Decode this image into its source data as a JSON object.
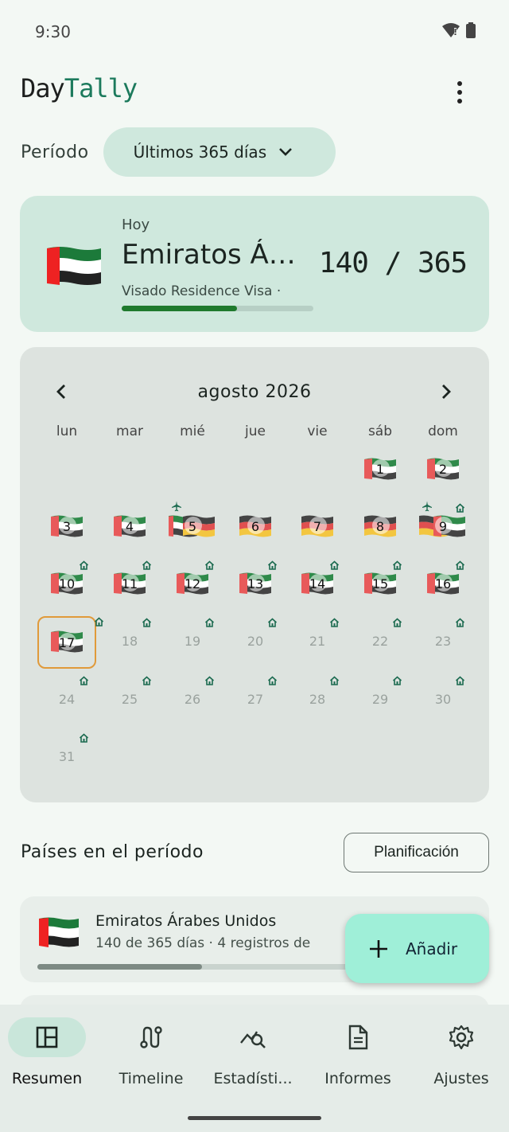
{
  "status": {
    "time": "9:30"
  },
  "app": {
    "name_part1": "Day",
    "name_part2": "Tally"
  },
  "period": {
    "label": "Período",
    "selected": "Últimos 365 días"
  },
  "today": {
    "label": "Hoy",
    "country": "Emiratos Árabes Unidos",
    "visa": "Visado Residence Visa ·",
    "count": "140 / 365",
    "progress_fraction": 0.6,
    "flag": "ae"
  },
  "calendar": {
    "month_title": "agosto 2026",
    "weekdays": [
      "lun",
      "mar",
      "mié",
      "jue",
      "vie",
      "sáb",
      "dom"
    ],
    "days": [
      {
        "n": "1",
        "col": 5,
        "row": 0,
        "flag": "ae"
      },
      {
        "n": "2",
        "col": 6,
        "row": 0,
        "flag": "ae"
      },
      {
        "n": "3",
        "col": 0,
        "row": 1,
        "flag": "ae"
      },
      {
        "n": "4",
        "col": 1,
        "row": 1,
        "flag": "ae"
      },
      {
        "n": "5",
        "col": 2,
        "row": 1,
        "flag": "ae-de",
        "plane": true
      },
      {
        "n": "6",
        "col": 3,
        "row": 1,
        "flag": "de"
      },
      {
        "n": "7",
        "col": 4,
        "row": 1,
        "flag": "de"
      },
      {
        "n": "8",
        "col": 5,
        "row": 1,
        "flag": "de"
      },
      {
        "n": "9",
        "col": 6,
        "row": 1,
        "flag": "de-ae",
        "plane": true,
        "house": true
      },
      {
        "n": "10",
        "col": 0,
        "row": 2,
        "flag": "ae",
        "house": true
      },
      {
        "n": "11",
        "col": 1,
        "row": 2,
        "flag": "ae",
        "house": true
      },
      {
        "n": "12",
        "col": 2,
        "row": 2,
        "flag": "ae",
        "house": true
      },
      {
        "n": "13",
        "col": 3,
        "row": 2,
        "flag": "ae",
        "house": true
      },
      {
        "n": "14",
        "col": 4,
        "row": 2,
        "flag": "ae",
        "house": true
      },
      {
        "n": "15",
        "col": 5,
        "row": 2,
        "flag": "ae",
        "house": true
      },
      {
        "n": "16",
        "col": 6,
        "row": 2,
        "flag": "ae",
        "house": true
      },
      {
        "n": "17",
        "col": 0,
        "row": 3,
        "flag": "ae",
        "house": true,
        "today": true
      },
      {
        "n": "18",
        "col": 1,
        "row": 3,
        "house": true,
        "future": true
      },
      {
        "n": "19",
        "col": 2,
        "row": 3,
        "house": true,
        "future": true
      },
      {
        "n": "20",
        "col": 3,
        "row": 3,
        "house": true,
        "future": true
      },
      {
        "n": "21",
        "col": 4,
        "row": 3,
        "house": true,
        "future": true
      },
      {
        "n": "22",
        "col": 5,
        "row": 3,
        "house": true,
        "future": true
      },
      {
        "n": "23",
        "col": 6,
        "row": 3,
        "house": true,
        "future": true
      },
      {
        "n": "24",
        "col": 0,
        "row": 4,
        "house": true,
        "future": true
      },
      {
        "n": "25",
        "col": 1,
        "row": 4,
        "house": true,
        "future": true
      },
      {
        "n": "26",
        "col": 2,
        "row": 4,
        "house": true,
        "future": true
      },
      {
        "n": "27",
        "col": 3,
        "row": 4,
        "house": true,
        "future": true
      },
      {
        "n": "28",
        "col": 4,
        "row": 4,
        "house": true,
        "future": true
      },
      {
        "n": "29",
        "col": 5,
        "row": 4,
        "house": true,
        "future": true
      },
      {
        "n": "30",
        "col": 6,
        "row": 4,
        "house": true,
        "future": true
      },
      {
        "n": "31",
        "col": 0,
        "row": 5,
        "house": true,
        "future": true
      }
    ]
  },
  "countries": {
    "title": "Países en el período",
    "planning_button": "Planificación",
    "items": [
      {
        "name": "Emiratos Árabes Unidos",
        "subtitle": "140 de 365 días  ·  4 registros de",
        "progress_fraction": 0.38,
        "flag": "ae"
      }
    ]
  },
  "fab": {
    "label": "Añadir"
  },
  "nav": {
    "items": [
      {
        "label": "Resumen",
        "icon": "dashboard-icon",
        "active": true
      },
      {
        "label": "Timeline",
        "icon": "route-icon"
      },
      {
        "label": "Estadísti...",
        "icon": "query-stats-icon"
      },
      {
        "label": "Informes",
        "icon": "document-icon"
      },
      {
        "label": "Ajustes",
        "icon": "gear-icon"
      }
    ]
  },
  "colors": {
    "accent": "#1c7a5c",
    "card": "#cfe8dd",
    "fab": "#9fefd8",
    "today_outline": "#e09a3a",
    "progress": "#1f7a2d"
  }
}
